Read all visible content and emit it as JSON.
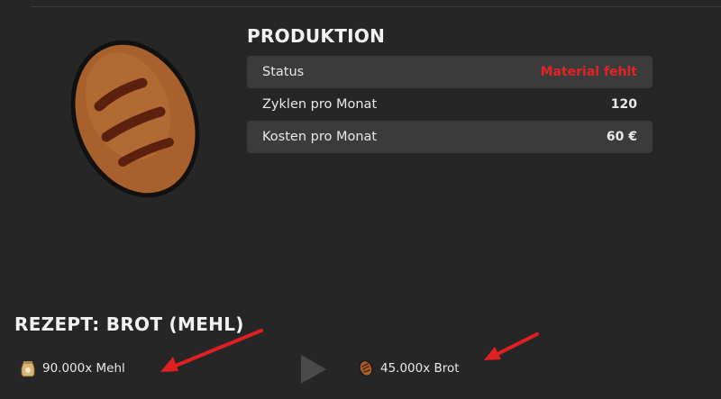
{
  "production": {
    "title": "PRODUKTION",
    "rows": [
      {
        "label": "Status",
        "value": "Material fehlt",
        "value_color": "#e42323"
      },
      {
        "label": "Zyklen pro Monat",
        "value": "120"
      },
      {
        "label": "Kosten pro Monat",
        "value": "60 €"
      }
    ]
  },
  "recipe": {
    "title": "REZEPT: BROT (MEHL)",
    "input": {
      "amount_label": "90.000x Mehl",
      "icon": "flour-sack-icon"
    },
    "output": {
      "amount_label": "45.000x Brot",
      "icon": "bread-icon"
    },
    "separator_icon": "play-arrow-icon"
  },
  "colors": {
    "background": "#262626",
    "row_highlight": "#3b3b3b",
    "alert": "#e42323",
    "annotation_arrow": "#e02020"
  }
}
